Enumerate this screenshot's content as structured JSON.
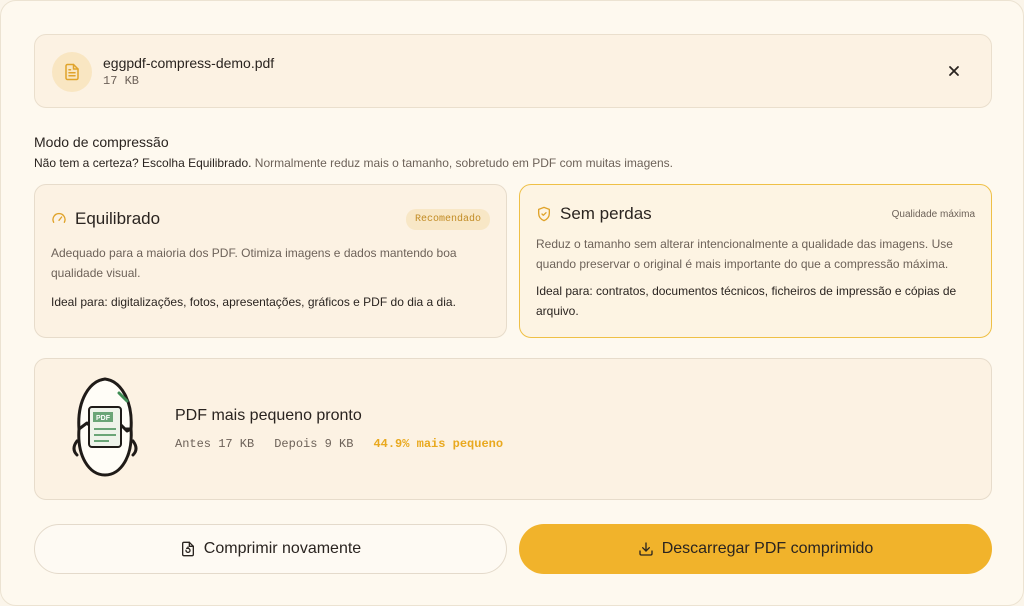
{
  "file": {
    "name": "eggpdf-compress-demo.pdf",
    "size": "17 KB"
  },
  "mode_section": {
    "title": "Modo de compressão",
    "hint_strong": "Não tem a certeza? Escolha Equilibrado.",
    "hint_rest": " Normalmente reduz mais o tamanho, sobretudo em PDF com muitas imagens."
  },
  "modes": [
    {
      "title": "Equilibrado",
      "badge": "Recomendado",
      "description": "Adequado para a maioria dos PDF. Otimiza imagens e dados mantendo boa qualidade visual.",
      "ideal": "Ideal para: digitalizações, fotos, apresentações, gráficos e PDF do dia a dia.",
      "selected": false,
      "icon": "gauge-icon"
    },
    {
      "title": "Sem perdas",
      "badge": "Qualidade máxima",
      "description": "Reduz o tamanho sem alterar intencionalmente a qualidade das imagens. Use quando preservar o original é mais importante do que a compressão máxima.",
      "ideal": "Ideal para: contratos, documentos técnicos, ficheiros de impressão e cópias de arquivo.",
      "selected": true,
      "icon": "shield-check-icon"
    }
  ],
  "result": {
    "title": "PDF mais pequeno pronto",
    "before": "Antes 17 KB",
    "after": "Depois 9 KB",
    "saving": "44.9% mais pequeno",
    "mascot_label": "PDF"
  },
  "actions": {
    "recompress_label": "Comprimir novamente",
    "download_label": "Descarregar PDF comprimido"
  },
  "colors": {
    "accent": "#f1b32b",
    "background": "#fef9ef",
    "card": "#fcf2e3",
    "saving_text": "#e9a91f"
  }
}
